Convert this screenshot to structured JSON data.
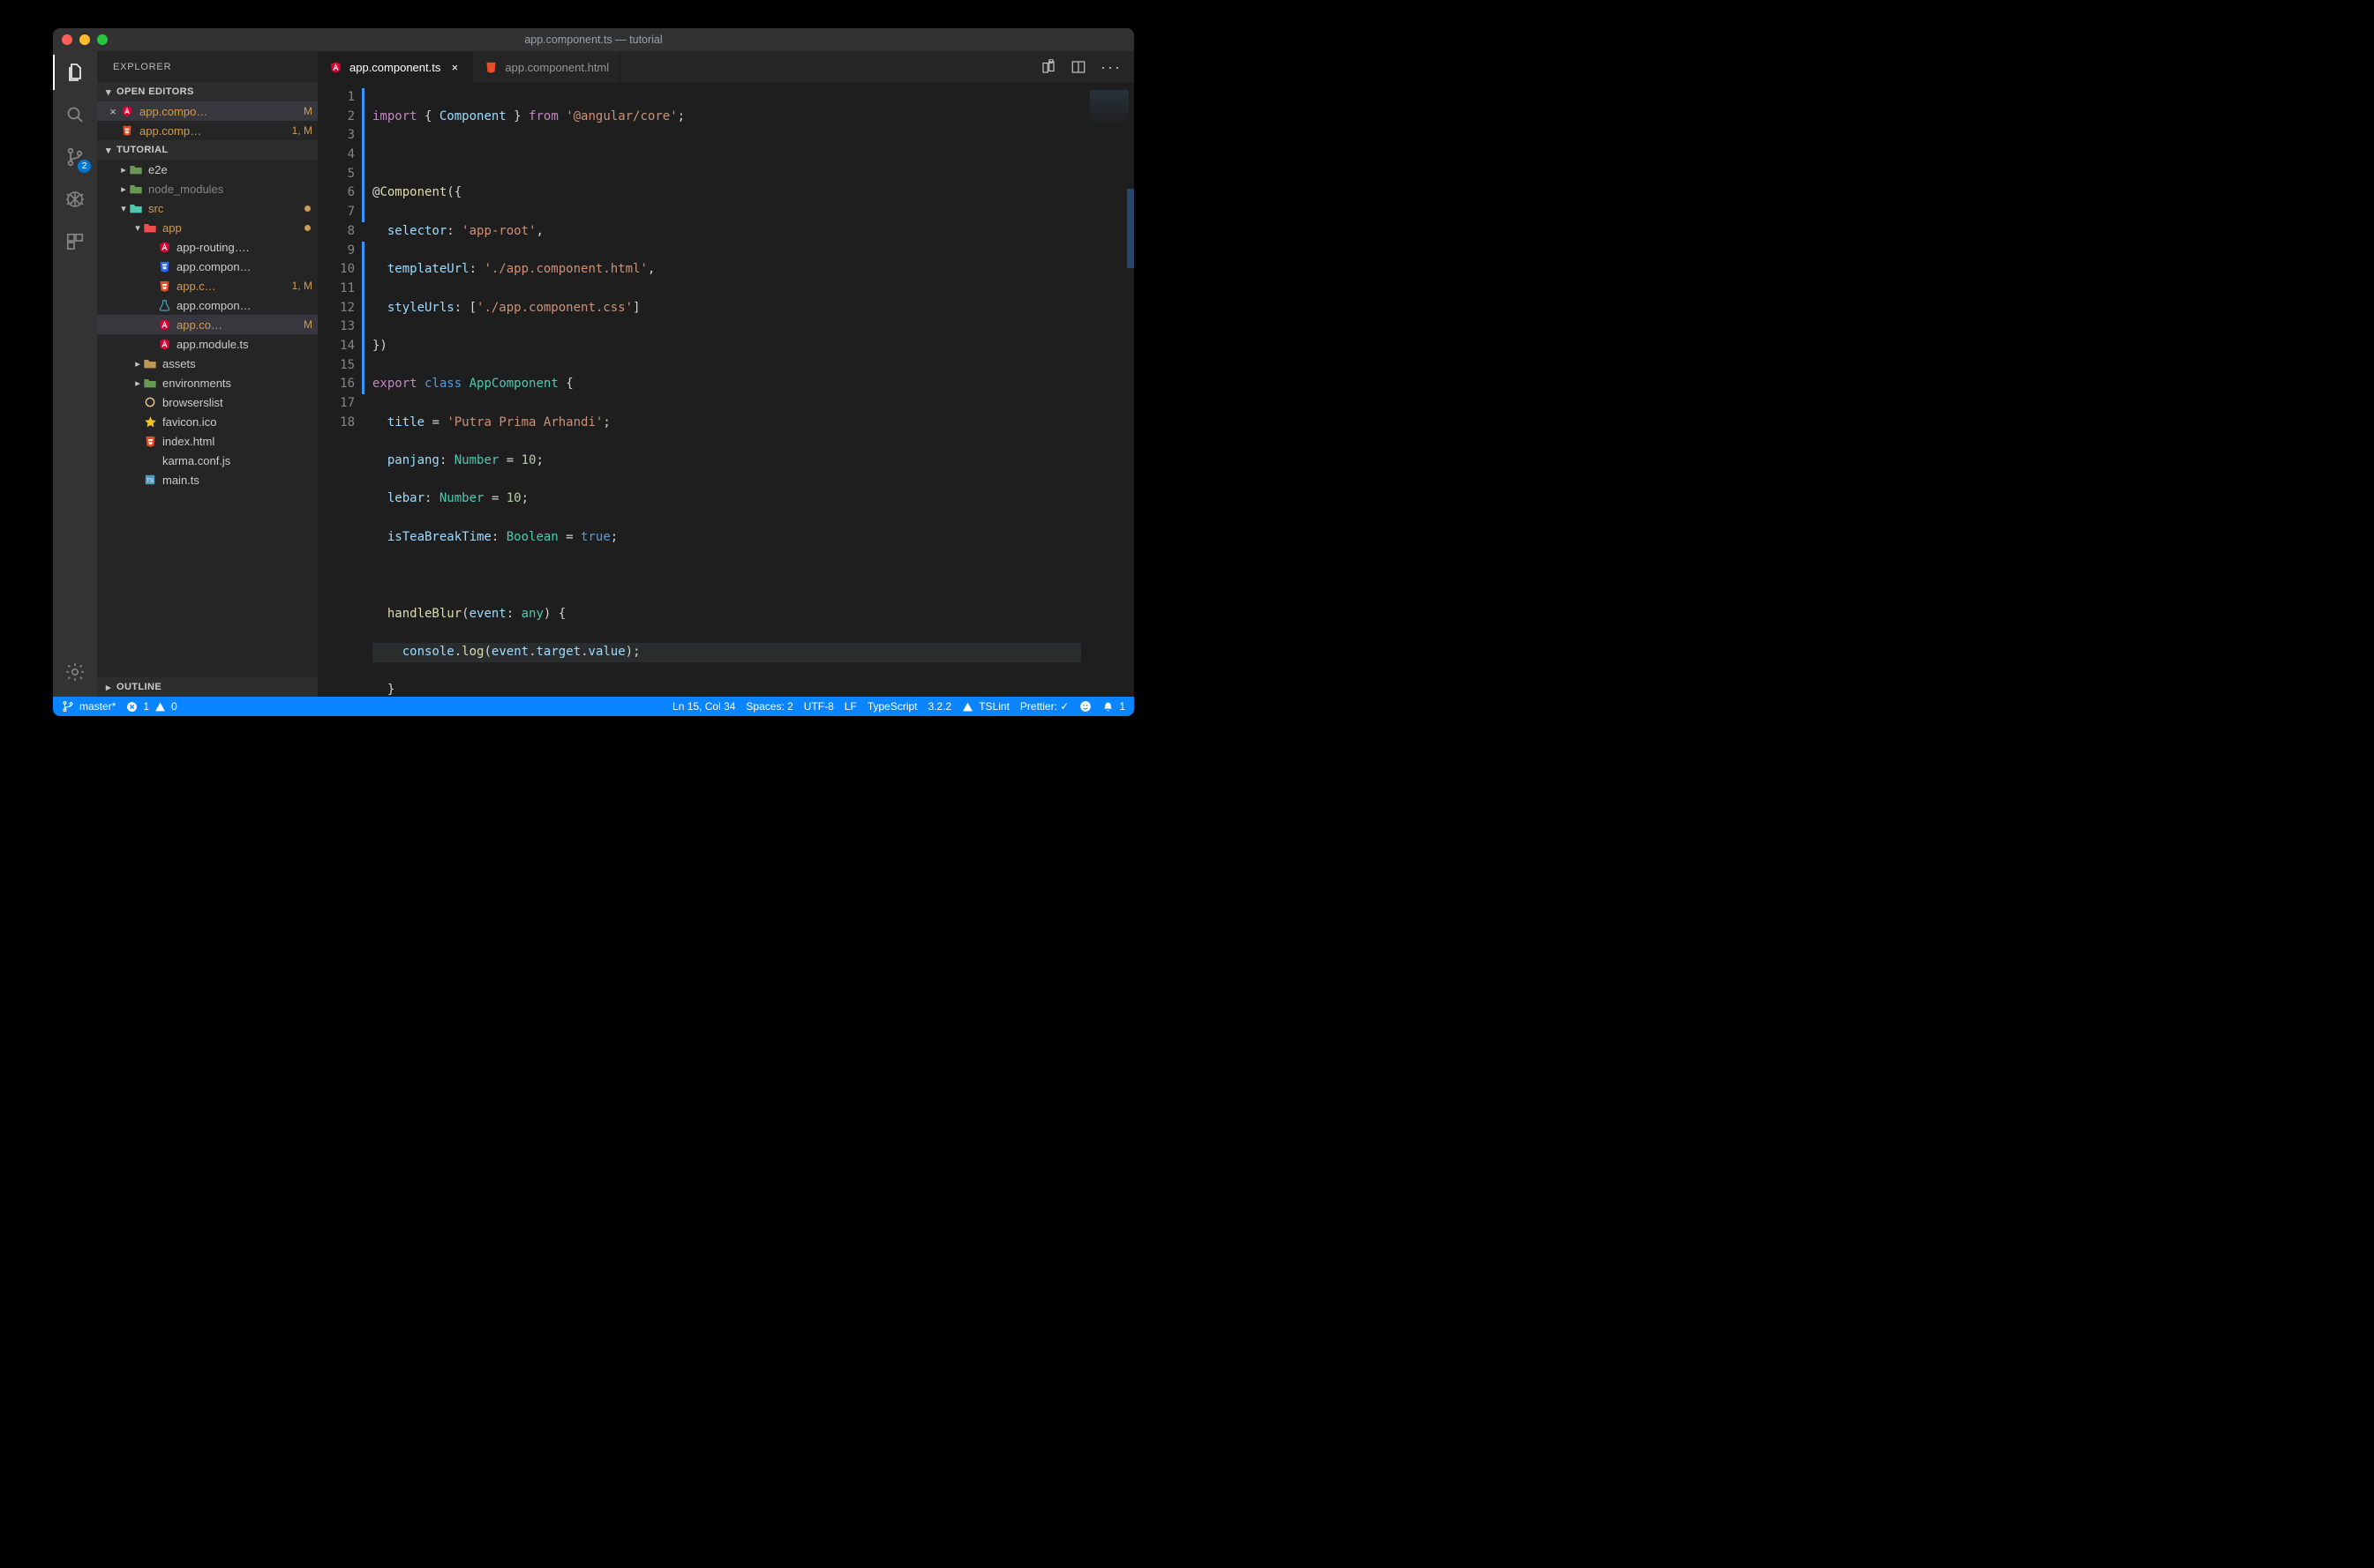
{
  "titlebar": {
    "title": "app.component.ts — tutorial"
  },
  "activitybar": {
    "scm_badge": "2"
  },
  "sidebar": {
    "title": "EXPLORER",
    "open_editors_header": "OPEN EDITORS",
    "open_editors": [
      {
        "label": "app.compo…",
        "badge": "M",
        "icon": "angular",
        "active": true
      },
      {
        "label": "app.comp…",
        "badge": "1, M",
        "icon": "html",
        "active": false
      }
    ],
    "project_header": "TUTORIAL",
    "tree": [
      {
        "indent": 1,
        "kind": "folder",
        "icon": "folder-green",
        "label": "e2e",
        "twisty": "right",
        "trunc": true
      },
      {
        "indent": 1,
        "kind": "folder",
        "icon": "folder-green",
        "label": "node_modules",
        "twisty": "right",
        "dim": true
      },
      {
        "indent": 1,
        "kind": "folder",
        "icon": "folder-src",
        "label": "src",
        "twisty": "down",
        "highlight": true,
        "modified": true
      },
      {
        "indent": 2,
        "kind": "folder",
        "icon": "folder-app",
        "label": "app",
        "twisty": "down",
        "highlight": true,
        "modified": true
      },
      {
        "indent": 3,
        "kind": "file",
        "icon": "angular",
        "label": "app-routing…."
      },
      {
        "indent": 3,
        "kind": "file",
        "icon": "css",
        "label": "app.compon…"
      },
      {
        "indent": 3,
        "kind": "file",
        "icon": "html",
        "label": "app.c…",
        "badge": "1, M",
        "highlight": true
      },
      {
        "indent": 3,
        "kind": "file",
        "icon": "test",
        "label": "app.compon…"
      },
      {
        "indent": 3,
        "kind": "file",
        "icon": "angular",
        "label": "app.co…",
        "badge": "M",
        "highlight": true,
        "selected": true
      },
      {
        "indent": 3,
        "kind": "file",
        "icon": "angular",
        "label": "app.module.ts"
      },
      {
        "indent": 2,
        "kind": "folder",
        "icon": "folder",
        "label": "assets",
        "twisty": "right"
      },
      {
        "indent": 2,
        "kind": "folder",
        "icon": "folder-green",
        "label": "environments",
        "twisty": "right"
      },
      {
        "indent": 2,
        "kind": "file",
        "icon": "circle",
        "label": "browserslist"
      },
      {
        "indent": 2,
        "kind": "file",
        "icon": "star",
        "label": "favicon.ico"
      },
      {
        "indent": 2,
        "kind": "file",
        "icon": "html",
        "label": "index.html"
      },
      {
        "indent": 2,
        "kind": "file",
        "icon": "karma",
        "label": "karma.conf.js"
      },
      {
        "indent": 2,
        "kind": "file",
        "icon": "ts",
        "label": "main.ts",
        "trunc": true
      }
    ],
    "outline_header": "OUTLINE"
  },
  "tabs": [
    {
      "label": "app.component.ts",
      "icon": "angular",
      "active": true,
      "close": "×"
    },
    {
      "label": "app.component.html",
      "icon": "html",
      "active": false,
      "close": ""
    }
  ],
  "editor": {
    "line_numbers": [
      "1",
      "2",
      "3",
      "4",
      "5",
      "6",
      "7",
      "8",
      "9",
      "10",
      "11",
      "12",
      "13",
      "14",
      "15",
      "16",
      "17",
      "18"
    ],
    "lines": {
      "l1": {
        "import": "import",
        "lbr": "{ ",
        "comp": "Component",
        "rbr": " }",
        "from": "from",
        "mod": "'@angular/core'",
        "sc": ";"
      },
      "l3": {
        "at": "@",
        "dec": "Component",
        "op": "({"
      },
      "l4": {
        "k": "selector",
        "c": ": ",
        "v": "'app-root'",
        "t": ","
      },
      "l5": {
        "k": "templateUrl",
        "c": ": ",
        "v": "'./app.component.html'",
        "t": ","
      },
      "l6": {
        "k": "styleUrls",
        "c": ": [",
        "v": "'./app.component.css'",
        "t": "]"
      },
      "l7": {
        "cl": "})"
      },
      "l8": {
        "exp": "export",
        "cls": "class",
        "name": "AppComponent",
        "br": "{"
      },
      "l9": {
        "k": "title",
        "eq": " = ",
        "v": "'Putra Prima Arhandi'",
        "sc": ";"
      },
      "l10": {
        "k": "panjang",
        "c": ": ",
        "t": "Number",
        "eq": " = ",
        "v": "10",
        "sc": ";"
      },
      "l11": {
        "k": "lebar",
        "c": ": ",
        "t": "Number",
        "eq": " = ",
        "v": "10",
        "sc": ";"
      },
      "l12": {
        "k": "isTeaBreakTime",
        "c": ": ",
        "t": "Boolean",
        "eq": " = ",
        "v": "true",
        "sc": ";"
      },
      "l14": {
        "fn": "handleBlur",
        "op": "(",
        "arg": "event",
        "c": ": ",
        "t": "any",
        "cp": ") {",
        "sp": ""
      },
      "l15": {
        "obj": "console",
        "dot": ".",
        "fn": "log",
        "op": "(",
        "a": "event",
        "d1": ".",
        "b": "target",
        "d2": ".",
        "c2": "value",
        "cp": ");"
      },
      "l16": {
        "cb": "}"
      },
      "l17": {
        "cb": "}"
      }
    }
  },
  "statusbar": {
    "branch": "master*",
    "errors": "1",
    "warnings": "0",
    "cursor": "Ln 15, Col 34",
    "spaces": "Spaces: 2",
    "encoding": "UTF-8",
    "eol": "LF",
    "lang": "TypeScript",
    "tsver": "3.2.2",
    "tslint": "TSLint",
    "prettier": "Prettier: ✓",
    "bell": "1"
  }
}
